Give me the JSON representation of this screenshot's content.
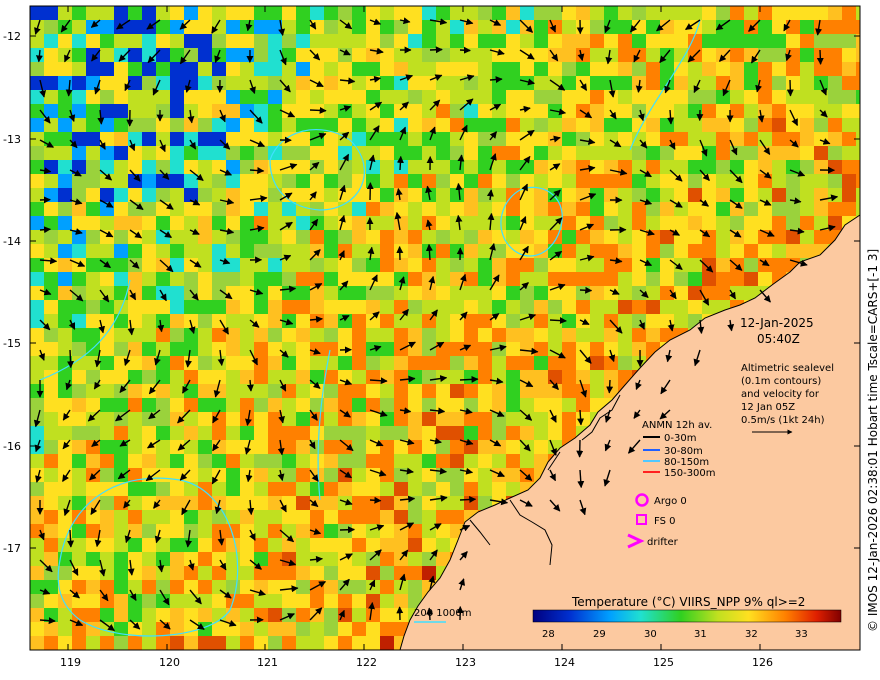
{
  "map": {
    "x_ticks": [
      "119",
      "120",
      "121",
      "122",
      "123",
      "124",
      "125",
      "126"
    ],
    "y_ticks": [
      "-12",
      "-13",
      "-14",
      "-15",
      "-16",
      "-17"
    ],
    "date": "12-Jan-2025",
    "time": "05:40Z",
    "altimetry_lines": [
      "Altimetric sealevel",
      "(0.1m contours)",
      "and velocity for",
      "12 Jan 05Z",
      "0.5m/s (1kt 24h)"
    ],
    "anmn_title": "ANMN 12h av.",
    "anmn_items": [
      {
        "label": "0-30m",
        "color": "#000000"
      },
      {
        "label": "30-80m",
        "color": "#2060ff"
      },
      {
        "label": "80-150m",
        "color": "#50c8ff"
      },
      {
        "label": "150-300m",
        "color": "#ff2020"
      }
    ],
    "argo_label": "Argo 0",
    "fs_label": "FS 0",
    "drifter_label": "drifter",
    "marker_color": "#ff00ff",
    "contour_label": "200  1000m",
    "contour_color": "#40e0ff",
    "land_color": "#fcc9a0",
    "colorbar_title": "Temperature (°C) VIIRS_NPP 9% ql>=2",
    "colorbar_ticks": [
      "28",
      "29",
      "30",
      "31",
      "32",
      "33"
    ],
    "credit": "© IMOS 12-Jan-2026 02:38:01 Hobart time Tscale=CARS+[-1 3]"
  }
}
